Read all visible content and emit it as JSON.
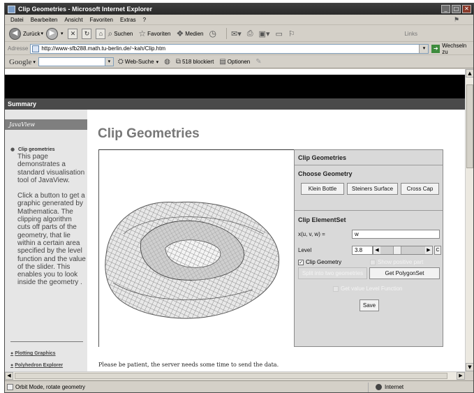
{
  "window": {
    "title": "Clip Geometries - Microsoft Internet Explorer",
    "controls": [
      "_",
      "□",
      "✕"
    ]
  },
  "menu": [
    "Datei",
    "Bearbeiten",
    "Ansicht",
    "Favoriten",
    "Extras",
    "?"
  ],
  "toolbar": {
    "back": "Zurück",
    "search": "Suchen",
    "favorites": "Favoriten",
    "media": "Medien",
    "links": "Links"
  },
  "address": {
    "label": "Adresse",
    "url": "http://www-sfb288.math.tu-berlin.de/~kah/Clip.htm",
    "go": "Wechseln zu"
  },
  "google": {
    "logo": "Google",
    "search_value": "",
    "web_search": "Web-Suche",
    "blocked": "518 blockiert",
    "options": "Optionen"
  },
  "page": {
    "summary": "Summary",
    "javaview": "JavaView",
    "title": "Clip Geometries",
    "nav_title": "Clip geometries",
    "nav_desc_1": "This page demonstrates a standard visualisation tool of JavaView.",
    "nav_desc_2": "Click a button to get a graphic generated by Mathematica. The clipping algorithm cuts off parts of the geometry, that lie within a certain area specified by the level function and the value of the slider. This enables you to look inside the geometry .",
    "links": [
      "Plotting Graphics",
      "Polyhedron Explorer"
    ],
    "patience": "Please be patient, the server needs some time to send the data."
  },
  "panel": {
    "header": "Clip Geometries",
    "choose": "Choose Geometry",
    "geometries": [
      "Klein Bottle",
      "Steiners Surface",
      "Cross Cap"
    ],
    "clip_header": "Clip ElementSet",
    "xuvw_label": "x(u, v, w) =",
    "xuvw_value": "w",
    "level_label": "Level",
    "level_value": "3.8",
    "slider_fraction": 0.35,
    "c_button": "C",
    "clip_geometry": "Clip Geometry",
    "clip_geometry_checked": true,
    "show_positive": "Show positive part",
    "split": "Split into two geometries",
    "get_polygon": "Get PolygonSet",
    "get_level": "Get value Level Function",
    "save": "Save"
  },
  "status": {
    "left": "Orbit Mode, rotate geometry",
    "zone": "Internet"
  }
}
